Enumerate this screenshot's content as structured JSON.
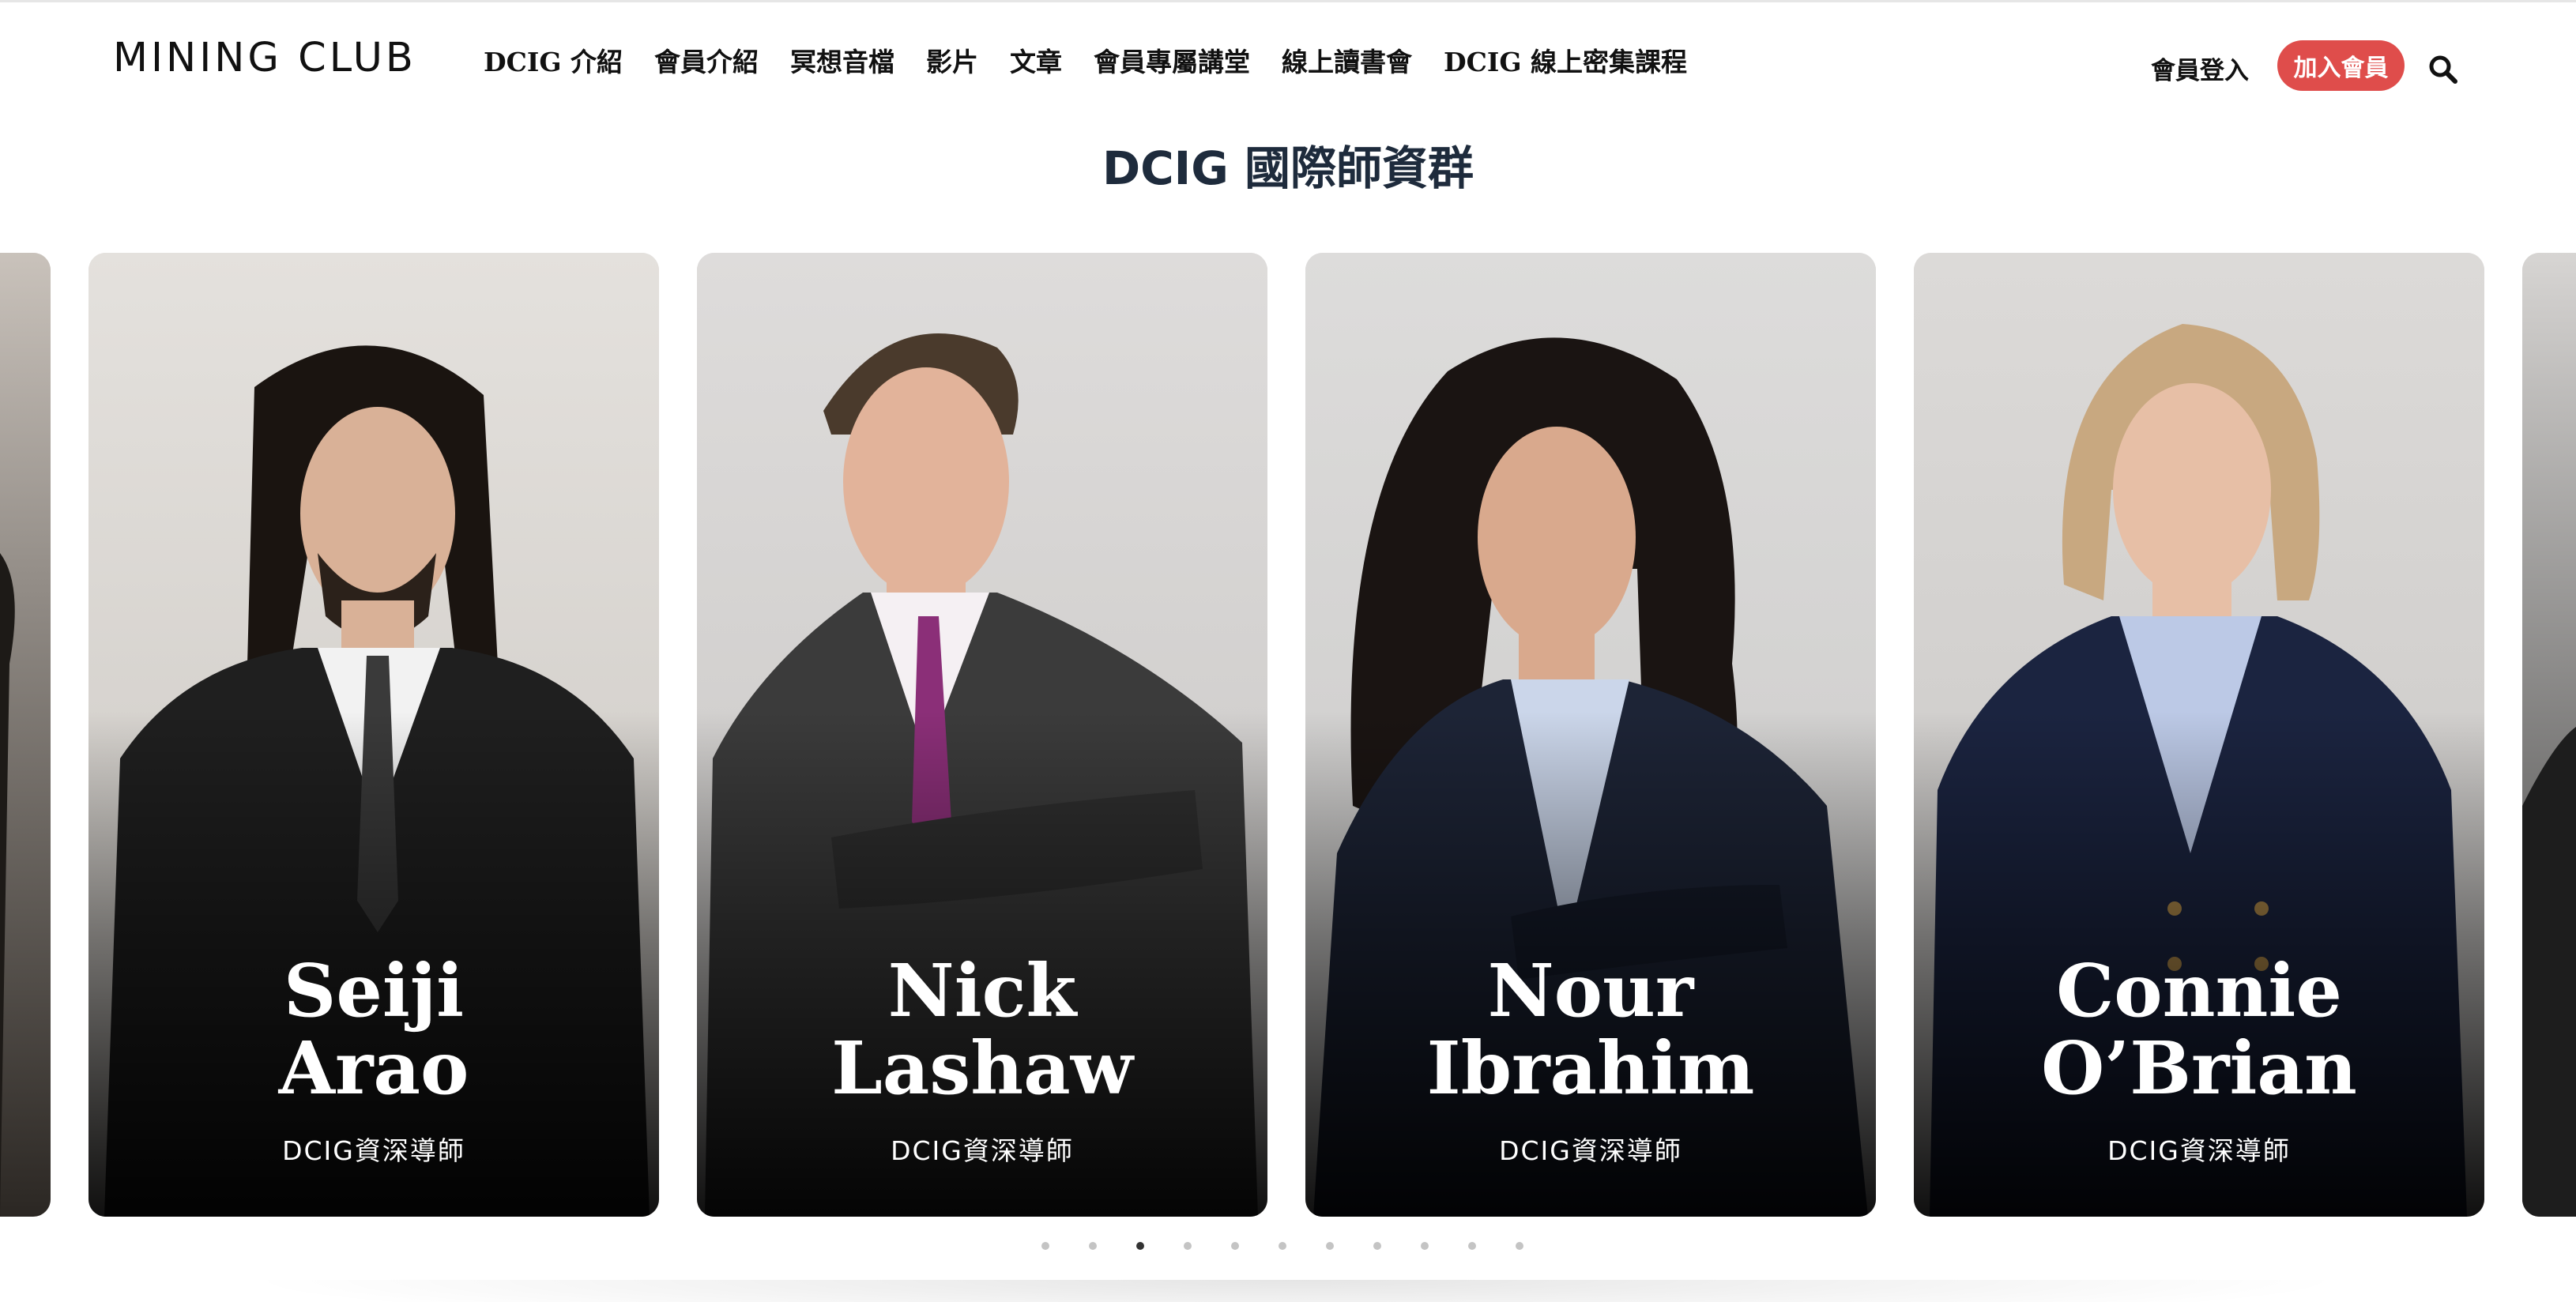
{
  "header": {
    "logo": "MINING CLUB",
    "nav": [
      "DCIG 介紹",
      "會員介紹",
      "冥想音檔",
      "影片",
      "文章",
      "會員專屬講堂",
      "線上讀書會",
      "DCIG 線上密集課程"
    ],
    "login": "會員登入",
    "join": "加入會員",
    "search_icon": "search-icon"
  },
  "section": {
    "title": "DCIG 國際師資群"
  },
  "carousel": {
    "cards": [
      {
        "first": "Seiji",
        "last": "Arao",
        "role": "DCIG資深導師",
        "suit": "#1f1f1f",
        "shirt": "#f2f2f2",
        "tie": "#3a3a3a",
        "hair": "#1a1410",
        "skin": "#d9b197"
      },
      {
        "first": "Nick",
        "last": "Lashaw",
        "role": "DCIG資深導師",
        "suit": "#3b3b3b",
        "shirt": "#f5f0f3",
        "tie": "#8b2f78",
        "hair": "#4a3a2c",
        "skin": "#e2b39a"
      },
      {
        "first": "Nour",
        "last": "Ibrahim",
        "role": "DCIG資深導師",
        "suit": "#1d2436",
        "shirt": "#cbd6ea",
        "tie": "",
        "hair": "#1a1412",
        "skin": "#d9a98d"
      },
      {
        "first": "Connie",
        "last": "O’Brian",
        "role": "DCIG資深導師",
        "suit": "#1b2440",
        "shirt": "#bcc9e6",
        "tie": "",
        "hair": "#c8a880",
        "skin": "#e7bfa6"
      }
    ],
    "dots_total": 11,
    "active_dot": 3
  }
}
